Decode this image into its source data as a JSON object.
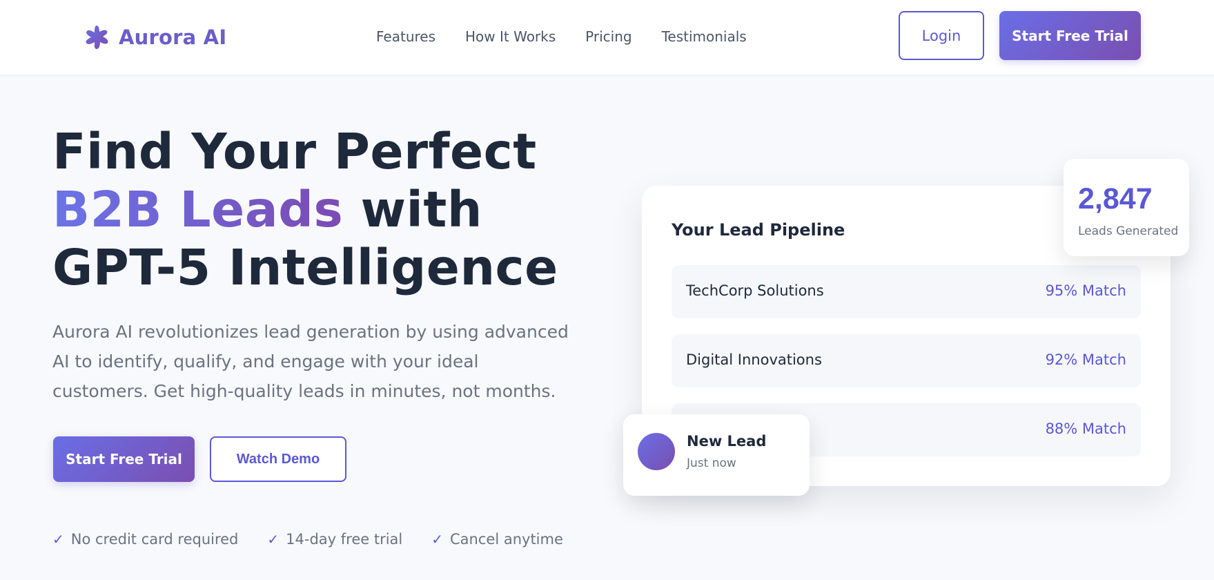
{
  "brand": {
    "name": "Aurora AI",
    "icon": "sparkle-icon",
    "color": "#6b5ec9"
  },
  "nav": {
    "items": [
      "Features",
      "How It Works",
      "Pricing",
      "Testimonials"
    ]
  },
  "header_actions": {
    "login_label": "Login",
    "trial_label": "Start Free Trial"
  },
  "hero": {
    "title_line1": "Find Your Perfect",
    "title_highlight": "B2B Leads",
    "title_line2_rest": " with",
    "title_line3": "GPT-5 Intelligence",
    "subtitle": "Aurora AI revolutionizes lead generation by using advanced AI to identify, qualify, and engage with your ideal customers. Get high-quality leads in minutes, not months.",
    "primary_cta": "Start Free Trial",
    "secondary_cta": "Watch Demo",
    "perks": [
      {
        "check": "✓",
        "text": "No credit card required"
      },
      {
        "check": "✓",
        "text": "14-day free trial"
      },
      {
        "check": "✓",
        "text": "Cancel anytime"
      }
    ]
  },
  "pipeline": {
    "title": "Your Lead Pipeline",
    "leads": [
      {
        "name": "TechCorp Solutions",
        "match": "95% Match"
      },
      {
        "name": "Digital Innovations",
        "match": "92% Match"
      },
      {
        "name": "",
        "match": "88% Match"
      }
    ]
  },
  "stat": {
    "value": "2,847",
    "label": "Leads Generated"
  },
  "toast": {
    "title": "New Lead",
    "time": "Just now"
  },
  "colors": {
    "accent": "#5b57d6",
    "gradient_start": "#6a6ee6",
    "gradient_end": "#7a4fb0",
    "heading": "#1e293b",
    "muted": "#6b7280"
  }
}
